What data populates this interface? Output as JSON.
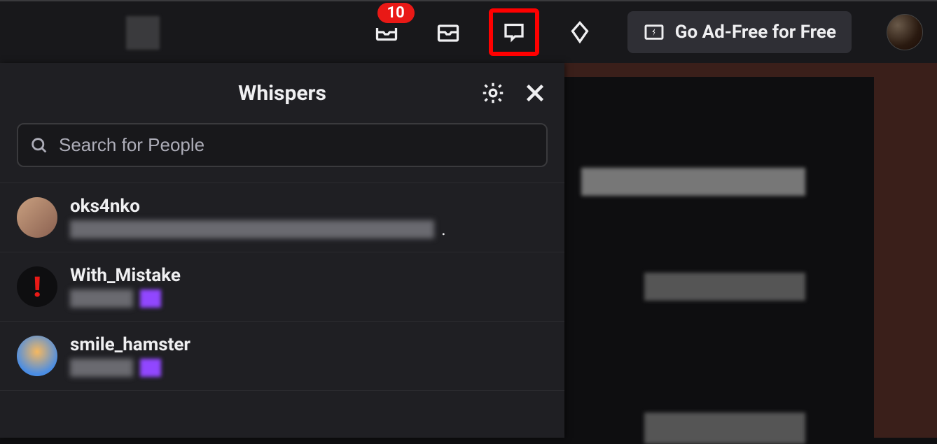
{
  "topbar": {
    "notification_count": "10",
    "adfree_label": "Go Ad-Free for Free"
  },
  "whispers": {
    "title": "Whispers",
    "search_placeholder": "Search for People",
    "conversations": [
      {
        "name": "oks4nko"
      },
      {
        "name": "With_Mistake"
      },
      {
        "name": "smile_hamster"
      }
    ]
  }
}
